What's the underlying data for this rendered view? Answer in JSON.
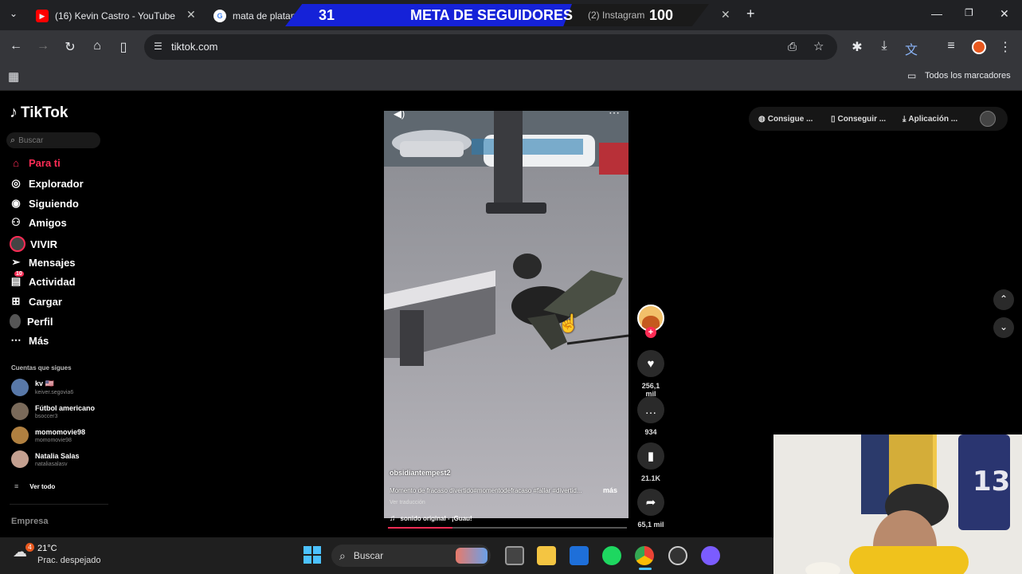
{
  "browser": {
    "tabs": [
      {
        "title": "(16) Kevin Castro - YouTube",
        "favicon": "youtube-icon",
        "color": "#ff0000"
      },
      {
        "title": "mata de platano",
        "favicon": "google-icon",
        "color": "#4285f4"
      },
      {
        "title": "(2) Instagram",
        "favicon": "instagram-icon",
        "color": "#c13584"
      }
    ],
    "url": "tiktok.com",
    "bookmarks_label": "Todos los marcadores"
  },
  "overlay_banner": {
    "current": "31",
    "title": "META DE SEGUIDORES",
    "goal": "100"
  },
  "tiktok": {
    "logo": "TikTok",
    "search_placeholder": "Buscar",
    "nav": [
      {
        "label": "Para ti",
        "icon": "home-icon",
        "active": true
      },
      {
        "label": "Explorador",
        "icon": "compass-icon"
      },
      {
        "label": "Siguiendo",
        "icon": "following-icon"
      },
      {
        "label": "Amigos",
        "icon": "friends-icon"
      },
      {
        "label": "VIVIR",
        "icon": "live-icon"
      },
      {
        "label": "Mensajes",
        "icon": "send-icon"
      },
      {
        "label": "Actividad",
        "icon": "bell-icon",
        "badge": "10"
      },
      {
        "label": "Cargar",
        "icon": "plus-square-icon"
      },
      {
        "label": "Perfil",
        "icon": "profile-icon"
      },
      {
        "label": "Más",
        "icon": "more-icon"
      }
    ],
    "following_header": "Cuentas que sigues",
    "following": [
      {
        "name": "kv 🇺🇸",
        "handle": "keiver.segovia6"
      },
      {
        "name": "Fútbol americano",
        "handle": "bsoccer3"
      },
      {
        "name": "momomovie98",
        "handle": "momomovie98"
      },
      {
        "name": "Natalia Salas",
        "handle": "nataliasalasv"
      }
    ],
    "see_all": "Ver todo",
    "footer": "Empresa",
    "top_buttons": [
      "Consigue ...",
      "Conseguir ...",
      "Aplicación ..."
    ],
    "video": {
      "author": "obsidiantempest2",
      "caption": "Momento de fracaso divertido#momentodefracaso #fallar #divertid...",
      "more": "más",
      "translate": "Ver traducción",
      "sound": "sonido original - ¡Guau!",
      "progress": 0.27
    },
    "actions": {
      "likes": "256,1 mil",
      "comments": "934",
      "saves": "21.1K",
      "shares": "65,1 mil"
    }
  },
  "taskbar": {
    "temperature": "21°C",
    "weather": "Prac. despejado",
    "weather_badge": "4",
    "search_label": "Buscar"
  },
  "colors": {
    "accent": "#fe2c55",
    "banner_blue": "#1522d8"
  }
}
